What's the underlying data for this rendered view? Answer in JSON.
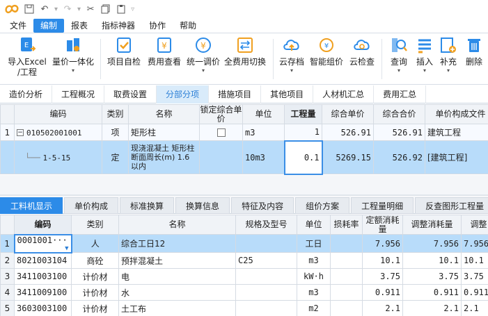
{
  "menu": [
    "文件",
    "编制",
    "报表",
    "指标神器",
    "协作",
    "帮助"
  ],
  "menu_active": 1,
  "ribbon": [
    {
      "label1": "导入Excel",
      "label2": "/工程",
      "icon": "import-excel-icon",
      "color": "#2c8be8"
    },
    {
      "label1": "量价一体化",
      "label2": "",
      "icon": "quantity-price-icon",
      "color": "#2c8be8"
    },
    {
      "label1": "项目自检",
      "label2": "",
      "icon": "self-check-icon",
      "color": "#f0a020"
    },
    {
      "label1": "费用查看",
      "label2": "",
      "icon": "fee-view-icon",
      "color": "#f0a020"
    },
    {
      "label1": "统一调价",
      "label2": "",
      "icon": "price-adjust-icon",
      "color": "#f0a020"
    },
    {
      "label1": "全费用切换",
      "label2": "",
      "icon": "full-fee-switch-icon",
      "color": "#f0a020"
    },
    {
      "label1": "云存档",
      "label2": "",
      "icon": "cloud-save-icon",
      "color": "#2c8be8"
    },
    {
      "label1": "智能组价",
      "label2": "",
      "icon": "smart-price-icon",
      "color": "#f0a020"
    },
    {
      "label1": "云检查",
      "label2": "",
      "icon": "cloud-check-icon",
      "color": "#2c8be8"
    },
    {
      "label1": "查询",
      "label2": "",
      "icon": "query-icon",
      "color": "#2c8be8"
    },
    {
      "label1": "插入",
      "label2": "",
      "icon": "insert-icon",
      "color": "#2c8be8"
    },
    {
      "label1": "补充",
      "label2": "",
      "icon": "supplement-icon",
      "color": "#2c8be8"
    },
    {
      "label1": "删除",
      "label2": "",
      "icon": "delete-icon",
      "color": "#2c8be8"
    }
  ],
  "view_tabs": [
    "造价分析",
    "工程概况",
    "取费设置",
    "分部分项",
    "措施项目",
    "其他项目",
    "人材机汇总",
    "费用汇总"
  ],
  "view_tab_active": 3,
  "upper_grid": {
    "headers": [
      "编码",
      "类别",
      "名称",
      "锁定综合单价",
      "单位",
      "工程量",
      "综合单价",
      "综合合价",
      "单价构成文件"
    ],
    "rows": [
      {
        "num": "1",
        "code": "010502001001",
        "type": "项",
        "name": "矩形柱",
        "unit": "m3",
        "qty": "1",
        "unit_price": "526.91",
        "total": "526.91",
        "file": "建筑工程"
      },
      {
        "num": "",
        "code": "1-5-15",
        "type": "定",
        "name": "现浇混凝土 矩形柱 断面周长(m) 1.6以内",
        "unit": "10m3",
        "qty": "0.1",
        "unit_price": "5269.15",
        "total": "526.92",
        "file": "[建筑工程]"
      }
    ]
  },
  "lower_tabs": [
    "工料机显示",
    "单价构成",
    "标准换算",
    "换算信息",
    "特征及内容",
    "组价方案",
    "工程量明细",
    "反查图形工程量"
  ],
  "lower_tab_active": 0,
  "lower_grid": {
    "headers": [
      "编码",
      "类别",
      "名称",
      "规格及型号",
      "单位",
      "损耗率",
      "定额消耗量",
      "调整消耗量",
      "调整"
    ],
    "rows": [
      {
        "num": "1",
        "code": "0001001···",
        "type": "人",
        "name": "综合工日12",
        "spec": "",
        "unit": "工日",
        "loss": "",
        "quota": "7.956",
        "adj": "7.956",
        "adj2": "7.956"
      },
      {
        "num": "2",
        "code": "8021003104",
        "type": "商砼",
        "name": "预拌混凝土",
        "spec": "C25",
        "unit": "m3",
        "loss": "",
        "quota": "10.1",
        "adj": "10.1",
        "adj2": "10.1"
      },
      {
        "num": "3",
        "code": "3411003100",
        "type": "计价材",
        "name": "电",
        "spec": "",
        "unit": "kW·h",
        "loss": "",
        "quota": "3.75",
        "adj": "3.75",
        "adj2": "3.75"
      },
      {
        "num": "4",
        "code": "3411009100",
        "type": "计价材",
        "name": "水",
        "spec": "",
        "unit": "m3",
        "loss": "",
        "quota": "0.911",
        "adj": "0.911",
        "adj2": "0.911"
      },
      {
        "num": "5",
        "code": "3603003100",
        "type": "计价材",
        "name": "土工布",
        "spec": "",
        "unit": "m2",
        "loss": "",
        "quota": "2.1",
        "adj": "2.1",
        "adj2": "2.1"
      }
    ]
  }
}
